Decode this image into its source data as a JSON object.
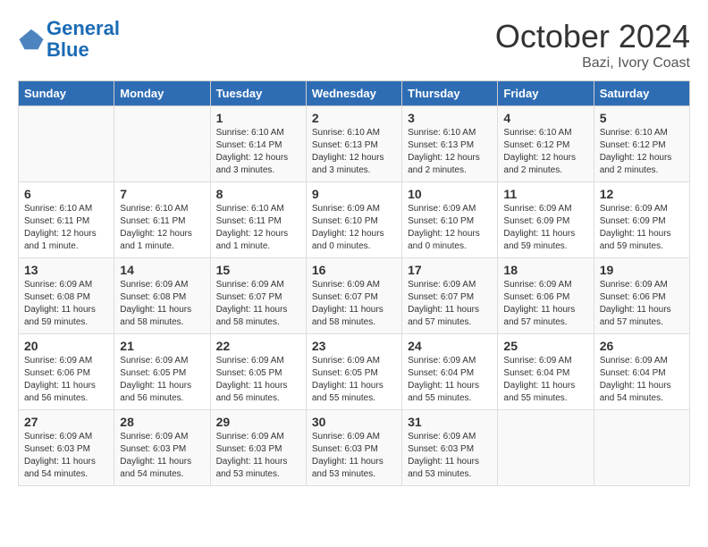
{
  "logo": {
    "line1": "General",
    "line2": "Blue"
  },
  "title": "October 2024",
  "subtitle": "Bazi, Ivory Coast",
  "days_of_week": [
    "Sunday",
    "Monday",
    "Tuesday",
    "Wednesday",
    "Thursday",
    "Friday",
    "Saturday"
  ],
  "weeks": [
    [
      {
        "day": "",
        "info": ""
      },
      {
        "day": "",
        "info": ""
      },
      {
        "day": "1",
        "info": "Sunrise: 6:10 AM\nSunset: 6:14 PM\nDaylight: 12 hours and 3 minutes."
      },
      {
        "day": "2",
        "info": "Sunrise: 6:10 AM\nSunset: 6:13 PM\nDaylight: 12 hours and 3 minutes."
      },
      {
        "day": "3",
        "info": "Sunrise: 6:10 AM\nSunset: 6:13 PM\nDaylight: 12 hours and 2 minutes."
      },
      {
        "day": "4",
        "info": "Sunrise: 6:10 AM\nSunset: 6:12 PM\nDaylight: 12 hours and 2 minutes."
      },
      {
        "day": "5",
        "info": "Sunrise: 6:10 AM\nSunset: 6:12 PM\nDaylight: 12 hours and 2 minutes."
      }
    ],
    [
      {
        "day": "6",
        "info": "Sunrise: 6:10 AM\nSunset: 6:11 PM\nDaylight: 12 hours and 1 minute."
      },
      {
        "day": "7",
        "info": "Sunrise: 6:10 AM\nSunset: 6:11 PM\nDaylight: 12 hours and 1 minute."
      },
      {
        "day": "8",
        "info": "Sunrise: 6:10 AM\nSunset: 6:11 PM\nDaylight: 12 hours and 1 minute."
      },
      {
        "day": "9",
        "info": "Sunrise: 6:09 AM\nSunset: 6:10 PM\nDaylight: 12 hours and 0 minutes."
      },
      {
        "day": "10",
        "info": "Sunrise: 6:09 AM\nSunset: 6:10 PM\nDaylight: 12 hours and 0 minutes."
      },
      {
        "day": "11",
        "info": "Sunrise: 6:09 AM\nSunset: 6:09 PM\nDaylight: 11 hours and 59 minutes."
      },
      {
        "day": "12",
        "info": "Sunrise: 6:09 AM\nSunset: 6:09 PM\nDaylight: 11 hours and 59 minutes."
      }
    ],
    [
      {
        "day": "13",
        "info": "Sunrise: 6:09 AM\nSunset: 6:08 PM\nDaylight: 11 hours and 59 minutes."
      },
      {
        "day": "14",
        "info": "Sunrise: 6:09 AM\nSunset: 6:08 PM\nDaylight: 11 hours and 58 minutes."
      },
      {
        "day": "15",
        "info": "Sunrise: 6:09 AM\nSunset: 6:07 PM\nDaylight: 11 hours and 58 minutes."
      },
      {
        "day": "16",
        "info": "Sunrise: 6:09 AM\nSunset: 6:07 PM\nDaylight: 11 hours and 58 minutes."
      },
      {
        "day": "17",
        "info": "Sunrise: 6:09 AM\nSunset: 6:07 PM\nDaylight: 11 hours and 57 minutes."
      },
      {
        "day": "18",
        "info": "Sunrise: 6:09 AM\nSunset: 6:06 PM\nDaylight: 11 hours and 57 minutes."
      },
      {
        "day": "19",
        "info": "Sunrise: 6:09 AM\nSunset: 6:06 PM\nDaylight: 11 hours and 57 minutes."
      }
    ],
    [
      {
        "day": "20",
        "info": "Sunrise: 6:09 AM\nSunset: 6:06 PM\nDaylight: 11 hours and 56 minutes."
      },
      {
        "day": "21",
        "info": "Sunrise: 6:09 AM\nSunset: 6:05 PM\nDaylight: 11 hours and 56 minutes."
      },
      {
        "day": "22",
        "info": "Sunrise: 6:09 AM\nSunset: 6:05 PM\nDaylight: 11 hours and 56 minutes."
      },
      {
        "day": "23",
        "info": "Sunrise: 6:09 AM\nSunset: 6:05 PM\nDaylight: 11 hours and 55 minutes."
      },
      {
        "day": "24",
        "info": "Sunrise: 6:09 AM\nSunset: 6:04 PM\nDaylight: 11 hours and 55 minutes."
      },
      {
        "day": "25",
        "info": "Sunrise: 6:09 AM\nSunset: 6:04 PM\nDaylight: 11 hours and 55 minutes."
      },
      {
        "day": "26",
        "info": "Sunrise: 6:09 AM\nSunset: 6:04 PM\nDaylight: 11 hours and 54 minutes."
      }
    ],
    [
      {
        "day": "27",
        "info": "Sunrise: 6:09 AM\nSunset: 6:03 PM\nDaylight: 11 hours and 54 minutes."
      },
      {
        "day": "28",
        "info": "Sunrise: 6:09 AM\nSunset: 6:03 PM\nDaylight: 11 hours and 54 minutes."
      },
      {
        "day": "29",
        "info": "Sunrise: 6:09 AM\nSunset: 6:03 PM\nDaylight: 11 hours and 53 minutes."
      },
      {
        "day": "30",
        "info": "Sunrise: 6:09 AM\nSunset: 6:03 PM\nDaylight: 11 hours and 53 minutes."
      },
      {
        "day": "31",
        "info": "Sunrise: 6:09 AM\nSunset: 6:03 PM\nDaylight: 11 hours and 53 minutes."
      },
      {
        "day": "",
        "info": ""
      },
      {
        "day": "",
        "info": ""
      }
    ]
  ]
}
